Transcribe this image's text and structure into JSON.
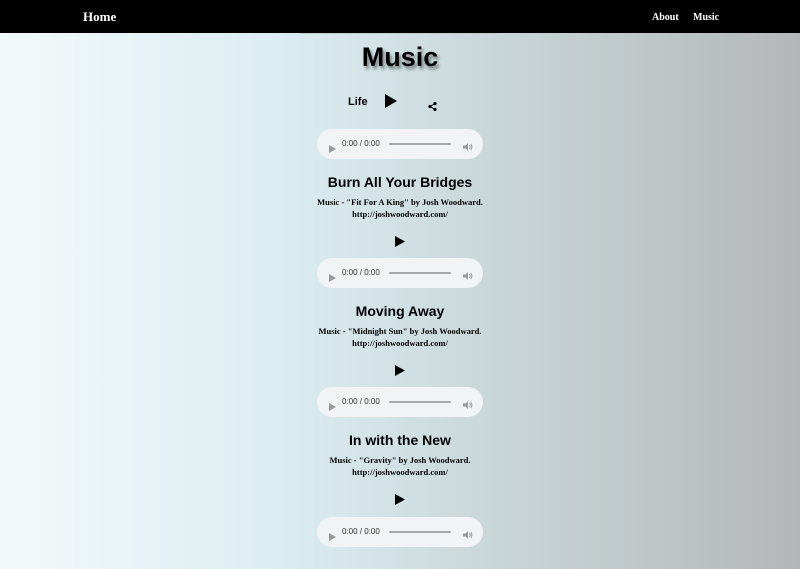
{
  "nav": {
    "home": "Home",
    "about": "About",
    "music": "Music"
  },
  "page": {
    "title": "Music"
  },
  "featured": {
    "label": "Life"
  },
  "player": {
    "time": "0:00 / 0:00"
  },
  "songs": [
    {
      "title": "Burn All Your Bridges",
      "credit": "Music - \"Fit For A King\" by Josh Woodward.",
      "url": "http://joshwoodward.com/"
    },
    {
      "title": "Moving Away",
      "credit": "Music - \"Midnight Sun\" by Josh Woodward.",
      "url": "http://joshwoodward.com/"
    },
    {
      "title": "In with the New",
      "credit": "Music - \"Gravity\" by Josh Woodward.",
      "url": "http://joshwoodward.com/"
    }
  ],
  "icons": {
    "play": "play-icon",
    "share": "share-icon",
    "volume": "volume-icon"
  }
}
